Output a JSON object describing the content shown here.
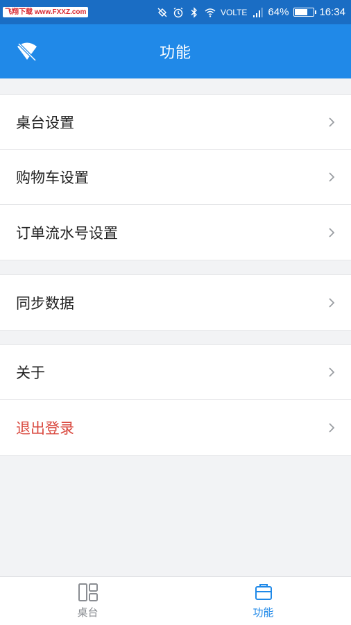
{
  "status_bar": {
    "watermark": "飞翔下载 www.FXXZ.com",
    "network": "VOLTE",
    "battery": "64%",
    "time": "16:34"
  },
  "header": {
    "title": "功能",
    "logo_icon": "wifi-off-icon"
  },
  "groups": [
    {
      "items": [
        {
          "label": "桌台设置"
        },
        {
          "label": "购物车设置"
        },
        {
          "label": "订单流水号设置"
        }
      ]
    },
    {
      "items": [
        {
          "label": "同步数据"
        }
      ]
    },
    {
      "items": [
        {
          "label": "关于"
        },
        {
          "label": "退出登录",
          "color": "#d9473d"
        }
      ]
    }
  ],
  "tab_bar": {
    "tabs": [
      {
        "label": "桌台",
        "icon": "table-layout-icon",
        "active": false
      },
      {
        "label": "功能",
        "icon": "function-icon",
        "active": true
      }
    ]
  },
  "colors": {
    "status_bar": "#1a6dc4",
    "primary": "#2089e8",
    "danger": "#d9473d",
    "background": "#f2f3f5"
  }
}
